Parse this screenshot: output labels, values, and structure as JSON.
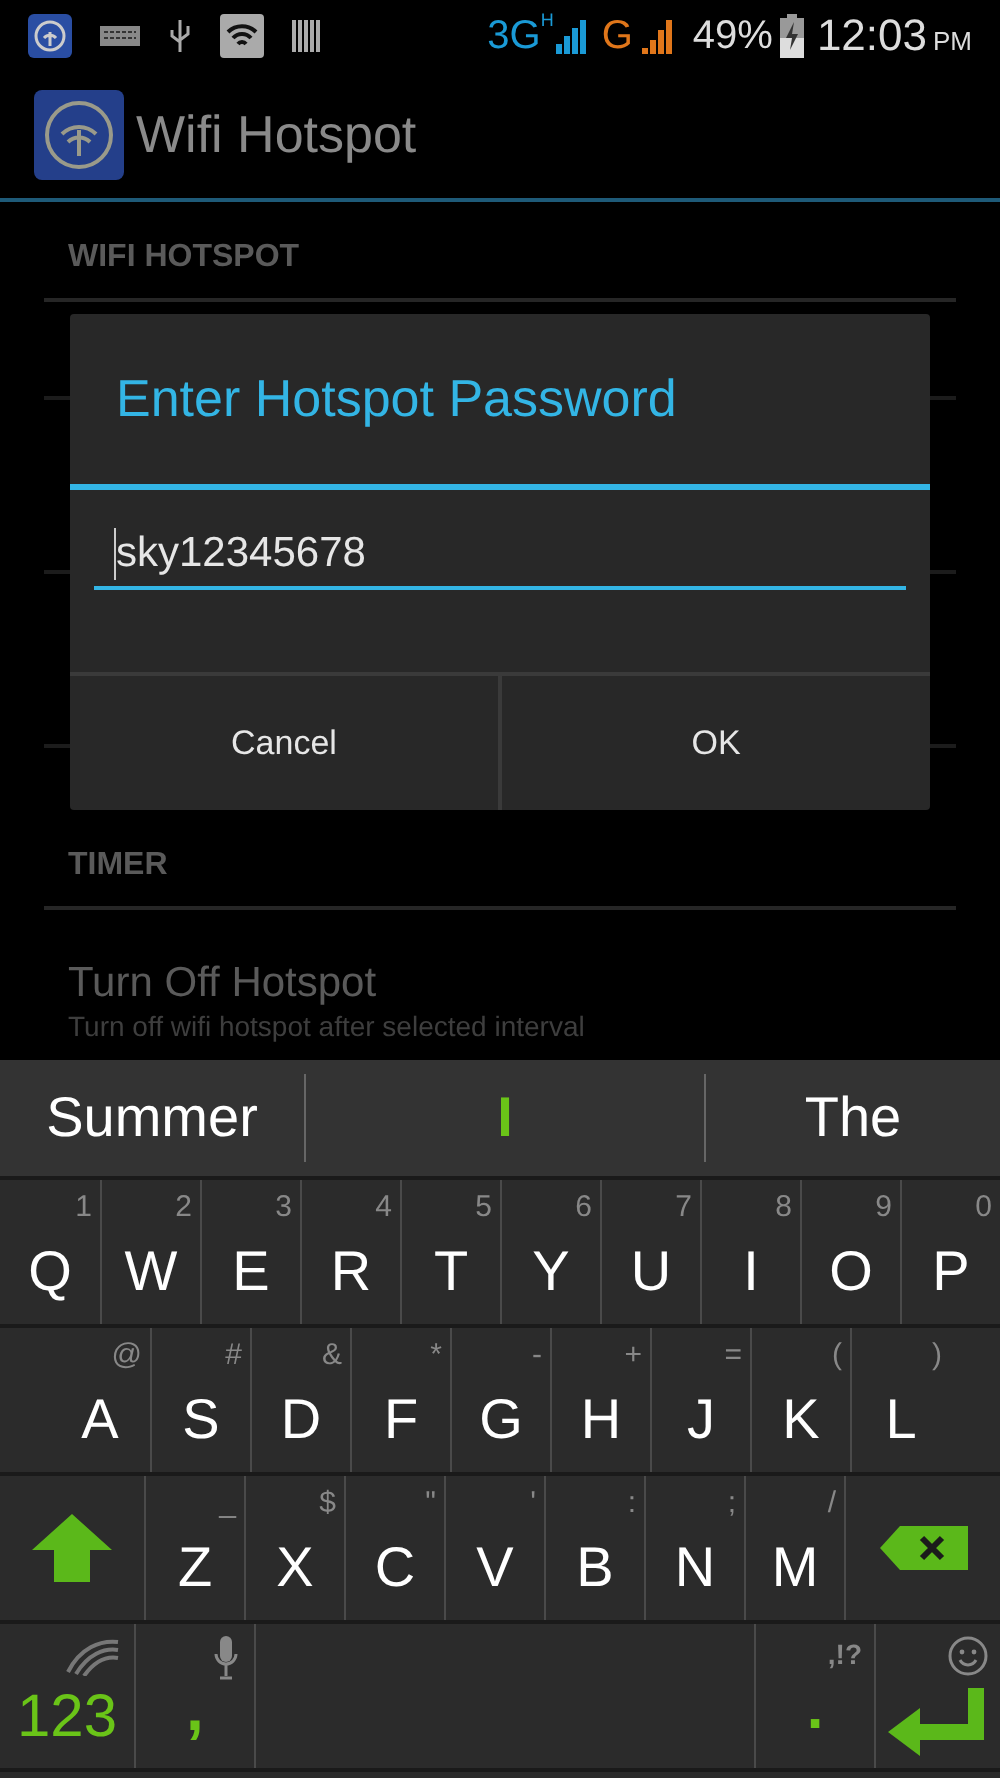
{
  "status_bar": {
    "network_1": "3G",
    "network_1_type": "H",
    "network_2": "G",
    "battery": "49%",
    "time": "12:03",
    "time_suffix": "PM"
  },
  "app_bar": {
    "title": "Wifi Hotspot"
  },
  "settings": [
    {
      "kind": "header",
      "title": "WIFI HOTSPOT"
    },
    {
      "kind": "covered"
    },
    {
      "kind": "header",
      "title": "TIMER"
    },
    {
      "kind": "item",
      "title": "Turn Off Hotspot",
      "subtitle": "Turn off wifi hotspot after selected interval"
    }
  ],
  "dialog": {
    "title": "Enter Hotspot Password",
    "value": "sky12345678",
    "buttons": [
      "Cancel",
      "OK"
    ]
  },
  "keyboard": {
    "suggestions": [
      {
        "label": "Summer",
        "selected": false
      },
      {
        "label": "I",
        "selected": true
      },
      {
        "label": "The",
        "selected": false
      }
    ],
    "rows": [
      [
        {
          "kind": "char",
          "label": "Q",
          "sub": "1"
        },
        {
          "kind": "char",
          "label": "W",
          "sub": "2"
        },
        {
          "kind": "char",
          "label": "E",
          "sub": "3"
        },
        {
          "kind": "char",
          "label": "R",
          "sub": "4"
        },
        {
          "kind": "char",
          "label": "T",
          "sub": "5"
        },
        {
          "kind": "char",
          "label": "Y",
          "sub": "6"
        },
        {
          "kind": "char",
          "label": "U",
          "sub": "7"
        },
        {
          "kind": "char",
          "label": "I",
          "sub": "8"
        },
        {
          "kind": "char",
          "label": "O",
          "sub": "9"
        },
        {
          "kind": "char",
          "label": "P",
          "sub": "0"
        }
      ],
      [
        {
          "kind": "char",
          "label": "A",
          "sub": "@"
        },
        {
          "kind": "char",
          "label": "S",
          "sub": "#"
        },
        {
          "kind": "char",
          "label": "D",
          "sub": "&"
        },
        {
          "kind": "char",
          "label": "F",
          "sub": "*"
        },
        {
          "kind": "char",
          "label": "G",
          "sub": "-"
        },
        {
          "kind": "char",
          "label": "H",
          "sub": "+"
        },
        {
          "kind": "char",
          "label": "J",
          "sub": "="
        },
        {
          "kind": "char",
          "label": "K",
          "sub": "("
        },
        {
          "kind": "char",
          "label": "L",
          "sub": ")"
        }
      ],
      [
        {
          "kind": "shift"
        },
        {
          "kind": "char",
          "label": "Z",
          "sub": "_"
        },
        {
          "kind": "char",
          "label": "X",
          "sub": "$"
        },
        {
          "kind": "char",
          "label": "C",
          "sub": "\""
        },
        {
          "kind": "char",
          "label": "V",
          "sub": "'"
        },
        {
          "kind": "char",
          "label": "B",
          "sub": ":"
        },
        {
          "kind": "char",
          "label": "N",
          "sub": ";"
        },
        {
          "kind": "char",
          "label": "M",
          "sub": "/"
        },
        {
          "kind": "backspace"
        }
      ],
      [
        {
          "kind": "symbols",
          "label": "123"
        },
        {
          "kind": "comma",
          "label": ","
        },
        {
          "kind": "space"
        },
        {
          "kind": "period",
          "label": ".",
          "sub": ",!?"
        },
        {
          "kind": "enter"
        }
      ]
    ]
  }
}
